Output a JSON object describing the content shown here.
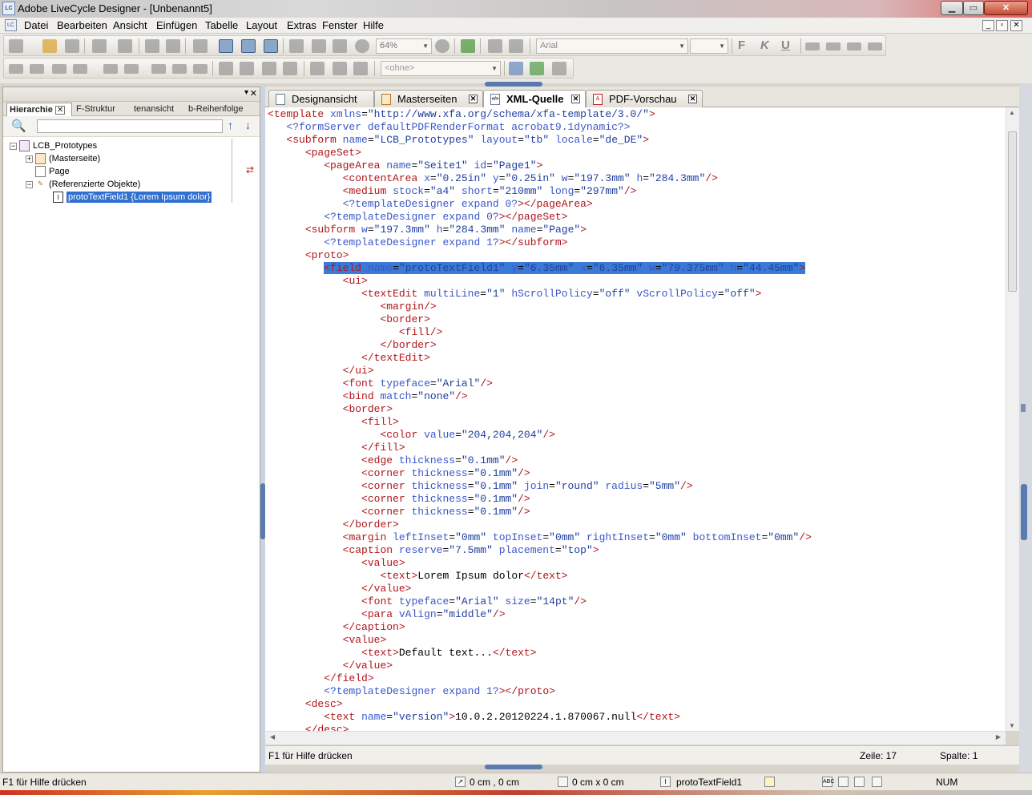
{
  "window": {
    "title": "Adobe LiveCycle Designer - [Unbenannt5]",
    "app_icon": "LC"
  },
  "menu": [
    "Datei",
    "Bearbeiten",
    "Ansicht",
    "Einfügen",
    "Tabelle",
    "Layout",
    "Extras",
    "Fenster",
    "Hilfe"
  ],
  "toolbar": {
    "zoom": "64%",
    "font": "Arial",
    "font_size": "",
    "style": "<ohne>",
    "bold": "F",
    "italic": "K",
    "underline": "U"
  },
  "left_panel": {
    "tabs": [
      {
        "label": "Hierarchie"
      },
      {
        "label": "F-Struktur"
      },
      {
        "label": "tenansicht"
      },
      {
        "label": "b-Reihenfolge"
      }
    ],
    "search_value": "",
    "tree": [
      {
        "label": "LCB_Prototypes"
      },
      {
        "label": "(Masterseite)"
      },
      {
        "label": "Page"
      },
      {
        "label": "(Referenzierte Objekte)"
      },
      {
        "label": "protoTextField1 {Lorem Ipsum dolor}"
      }
    ]
  },
  "editor_tabs": [
    {
      "label": "Designansicht"
    },
    {
      "label": "Masterseiten"
    },
    {
      "label": "XML-Quelle"
    },
    {
      "label": "PDF-Vorschau"
    }
  ],
  "code_lines": [
    "<template xmlns=\"http://www.xfa.org/schema/xfa-template/3.0/\">",
    "   <?formServer defaultPDFRenderFormat acrobat9.1dynamic?>",
    "   <subform name=\"LCB_Prototypes\" layout=\"tb\" locale=\"de_DE\">",
    "      <pageSet>",
    "         <pageArea name=\"Seite1\" id=\"Page1\">",
    "            <contentArea x=\"0.25in\" y=\"0.25in\" w=\"197.3mm\" h=\"284.3mm\"/>",
    "            <medium stock=\"a4\" short=\"210mm\" long=\"297mm\"/>",
    "            <?templateDesigner expand 0?></pageArea>",
    "         <?templateDesigner expand 0?></pageSet>",
    "      <subform w=\"197.3mm\" h=\"284.3mm\" name=\"Page\">",
    "         <?templateDesigner expand 1?></subform>",
    "      <proto>",
    "         <field name=\"protoTextField1\" y=\"6.35mm\" x=\"6.35mm\" w=\"79.375mm\" h=\"44.45mm\">",
    "            <ui>",
    "               <textEdit multiLine=\"1\" hScrollPolicy=\"off\" vScrollPolicy=\"off\">",
    "                  <margin/>",
    "                  <border>",
    "                     <fill/>",
    "                  </border>",
    "               </textEdit>",
    "            </ui>",
    "            <font typeface=\"Arial\"/>",
    "            <bind match=\"none\"/>",
    "            <border>",
    "               <fill>",
    "                  <color value=\"204,204,204\"/>",
    "               </fill>",
    "               <edge thickness=\"0.1mm\"/>",
    "               <corner thickness=\"0.1mm\"/>",
    "               <corner thickness=\"0.1mm\" join=\"round\" radius=\"5mm\"/>",
    "               <corner thickness=\"0.1mm\"/>",
    "               <corner thickness=\"0.1mm\"/>",
    "            </border>",
    "            <margin leftInset=\"0mm\" topInset=\"0mm\" rightInset=\"0mm\" bottomInset=\"0mm\"/>",
    "            <caption reserve=\"7.5mm\" placement=\"top\">",
    "               <value>",
    "                  <text>Lorem Ipsum dolor</text>",
    "               </value>",
    "               <font typeface=\"Arial\" size=\"14pt\"/>",
    "               <para vAlign=\"middle\"/>",
    "            </caption>",
    "            <value>",
    "               <text>Default text...</text>",
    "            </value>",
    "         </field>",
    "         <?templateDesigner expand 1?></proto>",
    "      <desc>",
    "         <text name=\"version\">10.0.2.20120224.1.870067.null</text>",
    "      </desc>"
  ],
  "highlighted_line": 12,
  "inner_status": {
    "help": "F1 für Hilfe drücken",
    "line": "Zeile: 17",
    "column": "Spalte: 1"
  },
  "status": {
    "help": "F1 für Hilfe drücken",
    "position": "0 cm , 0 cm",
    "size": "0 cm x 0 cm",
    "object": "protoTextField1",
    "num": "NUM"
  },
  "colors": {
    "tag": "#b0151b",
    "attr": "#3a57c9",
    "value": "#1f3fa0",
    "selection": "#3a7ad6"
  }
}
